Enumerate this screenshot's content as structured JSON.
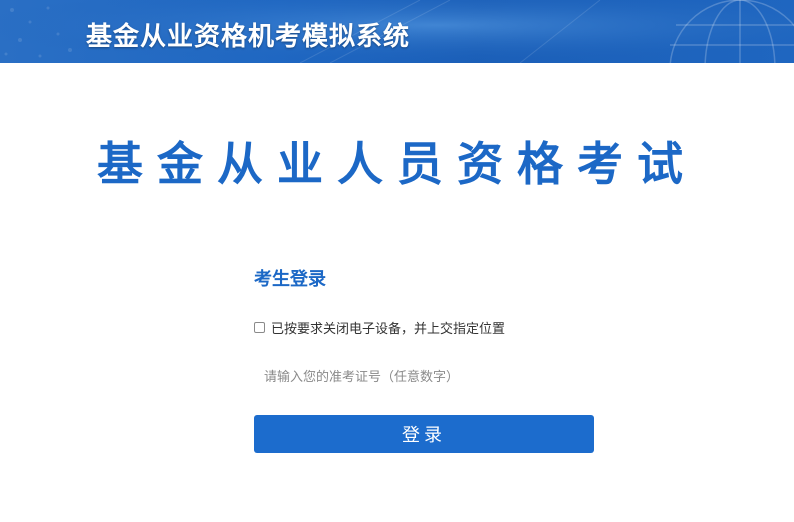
{
  "header": {
    "title": "基金从业资格机考模拟系统",
    "banner_color": "#1f66c0"
  },
  "main": {
    "title": "基金从业人员资格考试"
  },
  "login": {
    "heading": "考生登录",
    "agree_label": "已按要求关闭电子设备，并上交指定位置",
    "agree_checked": false,
    "id_placeholder": "请输入您的准考证号（任意数字）",
    "id_value": "",
    "submit_label": "登录"
  },
  "colors": {
    "accent": "#1c68c6",
    "button": "#1c6ccd"
  }
}
